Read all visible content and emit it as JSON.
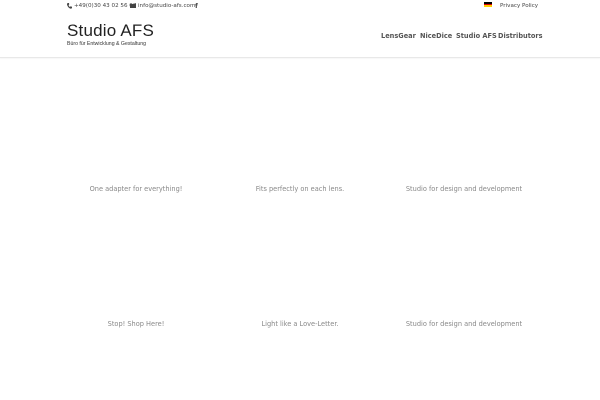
{
  "topbar": {
    "phone": "+49(0)30 43 02 56 07",
    "email": "info@studio-afs.com",
    "facebook_icon": "facebook-icon",
    "language_flag": "germany-flag-icon",
    "privacy": "Privacy Policy"
  },
  "logo": {
    "title": "Studio AFS",
    "subtitle": "Büro für Entwicklung & Gestaltung"
  },
  "nav": {
    "items": [
      {
        "label": "LensGear"
      },
      {
        "label": "NiceDice"
      },
      {
        "label": "Studio AFS"
      },
      {
        "label": "Distributors"
      }
    ]
  },
  "tiles": [
    {
      "caption": "One adapter for everything!"
    },
    {
      "caption": "Fits perfectly on each lens."
    },
    {
      "caption": "Studio for design and development"
    },
    {
      "caption": "Stop! Shop Here!"
    },
    {
      "caption": "Light like a Love-Letter."
    },
    {
      "caption": "Studio for design and development"
    }
  ],
  "colors": {
    "accent": "#2ea3f2",
    "text": "#666666",
    "flag_black": "#000000",
    "flag_red": "#dd0000",
    "flag_gold": "#ffce00"
  }
}
